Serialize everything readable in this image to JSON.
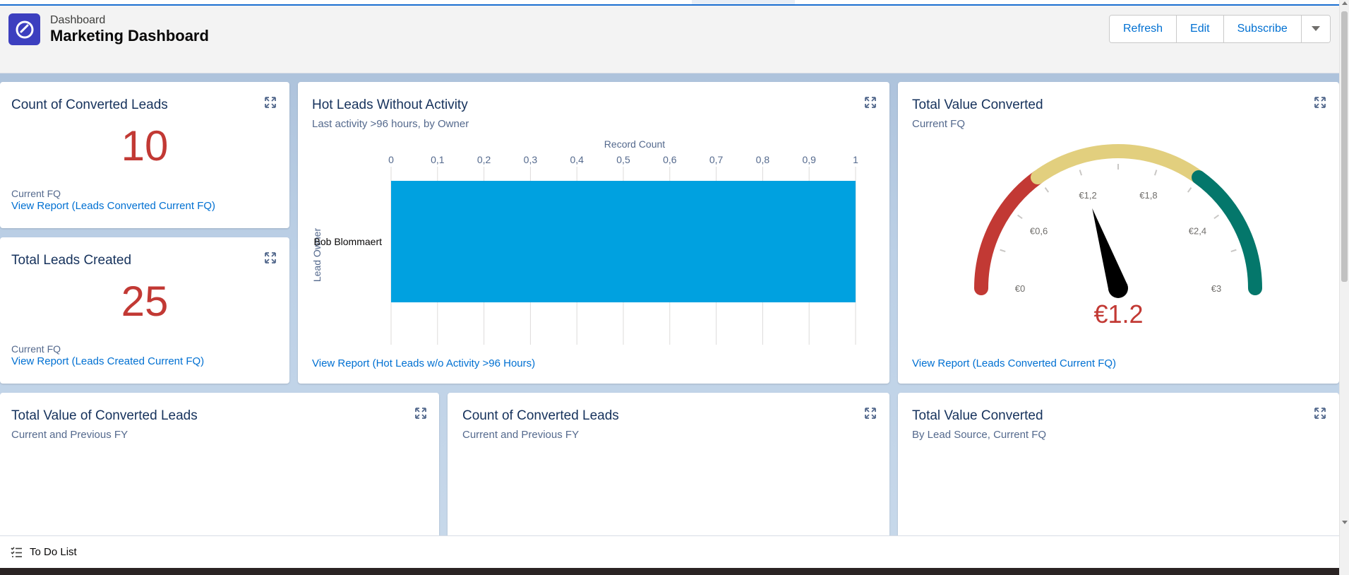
{
  "header": {
    "breadcrumb": "Dashboard",
    "title": "Marketing Dashboard",
    "buttons": {
      "refresh": "Refresh",
      "edit": "Edit",
      "subscribe": "Subscribe"
    },
    "menu_icon": "chevron-down-icon"
  },
  "cards": {
    "converted_leads": {
      "title": "Count of Converted Leads",
      "value": "10",
      "period": "Current FQ",
      "link": "View Report (Leads Converted Current FQ)"
    },
    "leads_created": {
      "title": "Total Leads Created",
      "value": "25",
      "period": "Current FQ",
      "link": "View Report (Leads Created Current FQ)"
    },
    "hot_leads": {
      "title": "Hot Leads Without Activity",
      "subtitle": "Last activity >96 hours, by Owner",
      "link": "View Report (Hot Leads w/o Activity >96 Hours)"
    },
    "total_value_gauge": {
      "title": "Total Value Converted",
      "subtitle": "Current FQ",
      "value_label": "€1.2",
      "link": "View Report (Leads Converted Current FQ)"
    },
    "value_converted_fy": {
      "title": "Total Value of Converted Leads",
      "subtitle": "Current and Previous FY"
    },
    "count_converted_fy": {
      "title": "Count of Converted Leads",
      "subtitle": "Current and Previous FY"
    },
    "value_by_source": {
      "title": "Total Value Converted",
      "subtitle": "By Lead Source, Current FQ"
    }
  },
  "chart_data": [
    {
      "type": "bar",
      "orientation": "horizontal",
      "title": "Hot Leads Without Activity",
      "xlabel": "Record Count",
      "ylabel": "Lead Owner",
      "categories": [
        "Bob Blommaert"
      ],
      "values": [
        1
      ],
      "xlim": [
        0,
        1
      ],
      "ticks": [
        "0",
        "0,1",
        "0,2",
        "0,3",
        "0,4",
        "0,5",
        "0,6",
        "0,7",
        "0,8",
        "0,9",
        "1"
      ],
      "color": "#00a1e0",
      "grid": true
    },
    {
      "type": "gauge",
      "title": "Total Value Converted",
      "value": 1.2,
      "range": [
        0,
        3
      ],
      "tick_labels": [
        "€0",
        "€0,6",
        "€1,2",
        "€1,8",
        "€2,4",
        "€3"
      ],
      "bands": [
        {
          "from": 0,
          "to": 0.9,
          "color": "#c23934"
        },
        {
          "from": 0.9,
          "to": 2.1,
          "color": "#e2cf7e"
        },
        {
          "from": 2.1,
          "to": 3,
          "color": "#04776b"
        }
      ]
    }
  ],
  "todo": {
    "label": "To Do List",
    "icon": "checklist-icon"
  },
  "colors": {
    "metric": "#c23934",
    "link": "#0070d2",
    "accent": "#3c3fbf"
  }
}
